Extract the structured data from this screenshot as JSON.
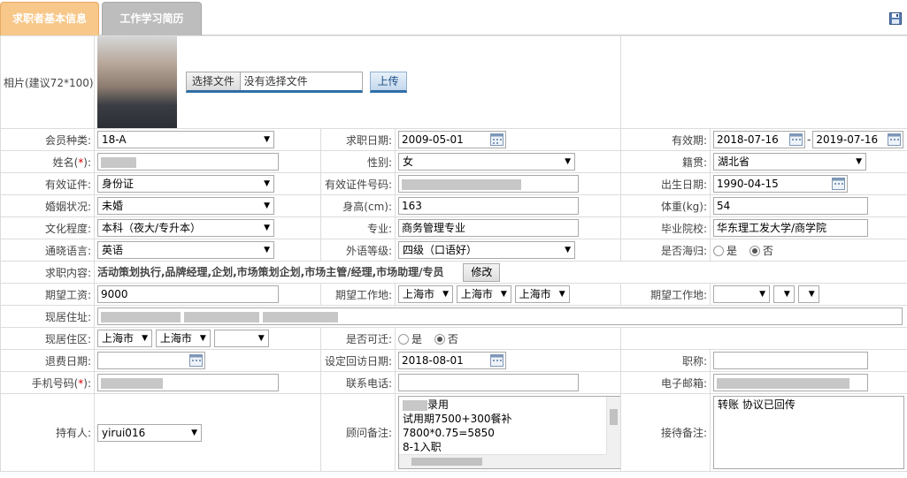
{
  "tabs": [
    {
      "label": "求职者基本信息"
    },
    {
      "label": "工作学习简历"
    }
  ],
  "photo": {
    "label": "相片(建议72*100):",
    "choose_file_button": "选择文件",
    "no_file_text": "没有选择文件",
    "upload_button": "上传"
  },
  "fields": {
    "member_type": {
      "label": "会员种类:",
      "value": "18-A"
    },
    "job_date": {
      "label": "求职日期:",
      "value": "2009-05-01"
    },
    "validity": {
      "label": "有效期:",
      "start": "2018-07-16",
      "sep": "-",
      "end": "2019-07-16"
    },
    "name": {
      "label": "姓名(",
      "req": "*",
      "label_end": "):"
    },
    "gender": {
      "label": "性别:",
      "value": "女"
    },
    "native_place": {
      "label": "籍贯:",
      "value": "湖北省"
    },
    "id_type": {
      "label": "有效证件:",
      "value": "身份证"
    },
    "id_number": {
      "label": "有效证件号码:"
    },
    "birth_date": {
      "label": "出生日期:",
      "value": "1990-04-15"
    },
    "marital": {
      "label": "婚姻状况:",
      "value": "未婚"
    },
    "height": {
      "label": "身高(cm):",
      "value": "163"
    },
    "weight": {
      "label": "体重(kg):",
      "value": "54"
    },
    "education": {
      "label": "文化程度:",
      "value": "本科（夜大/专升本）"
    },
    "major": {
      "label": "专业:",
      "value": "商务管理专业"
    },
    "school": {
      "label": "毕业院校:",
      "value": "华东理工发大学/商学院"
    },
    "language": {
      "label": "通晓语言:",
      "value": "英语"
    },
    "language_level": {
      "label": "外语等级:",
      "value": "四级（口语好）"
    },
    "returnee": {
      "label": "是否海归:",
      "yes": "是",
      "no": "否",
      "selected": "否"
    },
    "job_content": {
      "label": "求职内容:",
      "value": "活动策划执行,品牌经理,企划,市场策划企划,市场主管/经理,市场助理/专员",
      "edit_button": "修改"
    },
    "expected_salary": {
      "label": "期望工资:",
      "value": "9000"
    },
    "expected_location1": {
      "label": "期望工作地:",
      "values": [
        "上海市",
        "上海市",
        "上海市"
      ]
    },
    "expected_location2": {
      "label": "期望工作地:"
    },
    "current_address": {
      "label": "现居住址:"
    },
    "current_district": {
      "label": "现居住区:",
      "values": [
        "上海市",
        "上海市"
      ]
    },
    "relocate": {
      "label": "是否可迁:",
      "yes": "是",
      "no": "否",
      "selected": "否"
    },
    "refund_date": {
      "label": "退费日期:",
      "value": ""
    },
    "visit_date": {
      "label": "设定回访日期:",
      "value": "2018-08-01"
    },
    "title": {
      "label": "职称:",
      "value": ""
    },
    "mobile": {
      "label": "手机号码(",
      "req": "*",
      "label_end": "):"
    },
    "phone": {
      "label": "联系电话:",
      "value": ""
    },
    "email": {
      "label": "电子邮箱:"
    },
    "owner": {
      "label": "持有人:",
      "value": "yirui016"
    },
    "consultant_note": {
      "label": "顾问备注:",
      "lines": [
        "录用",
        "试用期7500+300餐补",
        "7800*0.75=5850",
        "8-1入职"
      ]
    },
    "reception_note": {
      "label": "接待备注:",
      "value": "转账  协议已回传"
    }
  }
}
